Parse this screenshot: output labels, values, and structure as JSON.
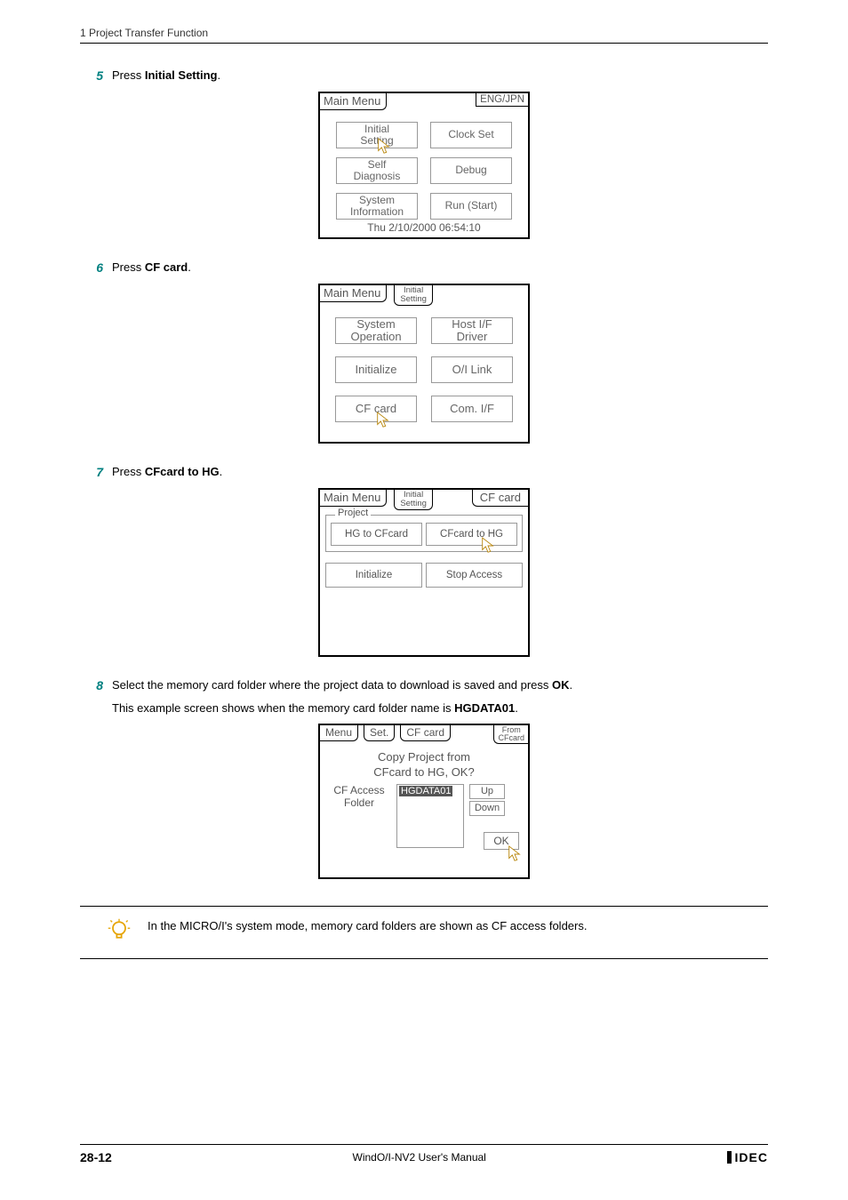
{
  "header": {
    "title": "1 Project Transfer Function"
  },
  "step5": {
    "num": "5",
    "pre": "Press ",
    "bold": "Initial Setting",
    "post": "."
  },
  "screen1": {
    "mainMenu": "Main Menu",
    "engJpn": "ENG/JPN",
    "b1": "Initial\nSetting",
    "b2": "Clock Set",
    "b3": "Self\nDiagnosis",
    "b4": "Debug",
    "b5": "System\nInformation",
    "b6": "Run (Start)",
    "date": "Thu  2/10/2000 06:54:10"
  },
  "step6": {
    "num": "6",
    "pre": "Press ",
    "bold": "CF card",
    "post": "."
  },
  "screen2": {
    "mainMenu": "Main Menu",
    "initial": "Initial\nSetting",
    "b1": "System\nOperation",
    "b2": "Host I/F\nDriver",
    "b3": "Initialize",
    "b4": "O/I Link",
    "b5": "CF card",
    "b6": "Com. I/F"
  },
  "step7": {
    "num": "7",
    "pre": "Press ",
    "bold": "CFcard to HG",
    "post": "."
  },
  "screen3": {
    "mainMenu": "Main Menu",
    "initial": "Initial\nSetting",
    "cfcard": "CF card",
    "group": "Project",
    "b1": "HG to CFcard",
    "b2": "CFcard to HG",
    "b3": "Initialize",
    "b4": "Stop Access"
  },
  "step8": {
    "num": "8",
    "line1a": "Select the memory card folder where the project data to download is saved and press ",
    "line1b": "OK",
    "line1c": ".",
    "line2a": "This example screen shows when the memory card folder name is ",
    "line2b": "HGDATA01",
    "line2c": "."
  },
  "screen4": {
    "t1": "Menu",
    "t2": "Set.",
    "t3": "CF card",
    "t4": "From\nCFcard",
    "msg1": "Copy Project from",
    "msg2": "CFcard to HG, OK?",
    "leftLabel": "CF Access\nFolder",
    "sel": "HGDATA01",
    "up": "Up",
    "down": "Down",
    "ok": "OK"
  },
  "note": "In the MICRO/I's system mode, memory card folders are shown as CF access folders.",
  "footer": {
    "page": "28-12",
    "center": "WindO/I-NV2 User's Manual",
    "brand": "IDEC"
  }
}
